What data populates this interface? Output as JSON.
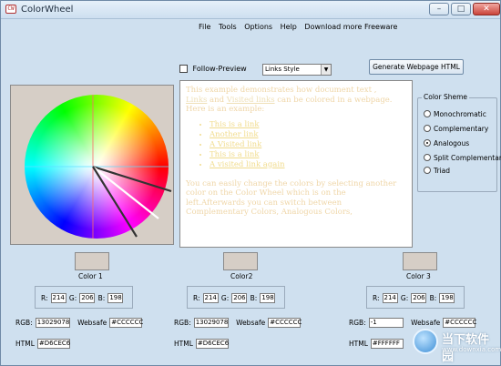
{
  "window": {
    "title": "ColorWheel",
    "icon_text": "CW",
    "minimize": "–",
    "maximize": "□",
    "close": "✕"
  },
  "menu": [
    "File",
    "Tools",
    "Options",
    "Help",
    "Download more Freeware"
  ],
  "controls": {
    "follow_preview_label": "Follow-Preview",
    "follow_preview_checked": false,
    "style_select_value": "Links Style",
    "generate_button": "Generate Webpage HTML"
  },
  "preview": {
    "p1_a": "This example demonstrates how document text ,",
    "p1_link": "Links",
    "p1_b": " and ",
    "p1_visited": "Visited links",
    "p1_c": " can be colored in a webpage.",
    "p1_d": "Here is an example:",
    "items": [
      "This is a link",
      "Another link",
      "A Visited link",
      "This is a link",
      "A visited link again"
    ],
    "p2": "You can easily change the colors by selecting another color on the Color Wheel which is on the left.Afterwards you can switch between Complementary Colors, Analogous Colors,"
  },
  "scheme": {
    "legend": "Color Sheme",
    "options": [
      "Monochromatic",
      "Complementary",
      "Analogous",
      "Split Complementary",
      "Triad"
    ],
    "selected": "Analogous"
  },
  "colors": [
    {
      "label": "Color 1",
      "r": "214",
      "g": "206",
      "b": "198",
      "rgb": "13029078",
      "websafe": "#CCCCCC",
      "html": "#D6CEC6",
      "swatch": "#d6cec6"
    },
    {
      "label": "Color2",
      "r": "214",
      "g": "206",
      "b": "198",
      "rgb": "13029078",
      "websafe": "#CCCCCC",
      "html": "#D6CEC6",
      "swatch": "#d6cec6"
    },
    {
      "label": "Color 3",
      "r": "214",
      "g": "206",
      "b": "198",
      "rgb": "-1",
      "websafe": "#CCCCCC",
      "html": "#FFFFFF",
      "swatch": "#d6cec6"
    }
  ],
  "field_labels": {
    "r": "R:",
    "g": "G:",
    "b": "B:",
    "rgb": "RGB:",
    "websafe": "Websafe",
    "html": "HTML"
  },
  "watermark": {
    "title": "当下软件园",
    "url": "www.downxia.com"
  }
}
